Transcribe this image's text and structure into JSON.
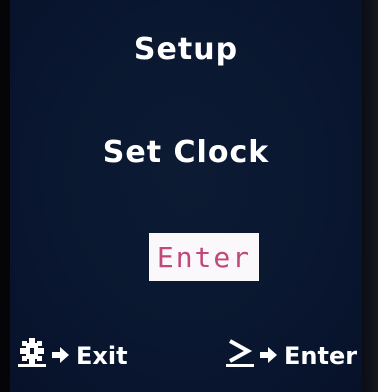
{
  "screen": {
    "title": "Setup",
    "subtitle": "Set Clock",
    "enter_label": "Enter"
  },
  "footer": {
    "left": {
      "icon": "gear-icon",
      "label": "Exit"
    },
    "right": {
      "icon": "greater-than-icon",
      "label": "Enter"
    }
  },
  "colors": {
    "background": "#0a1730",
    "text": "#ffffff",
    "highlight_bg": "#fbf8fb",
    "highlight_text": "#c0497a"
  }
}
